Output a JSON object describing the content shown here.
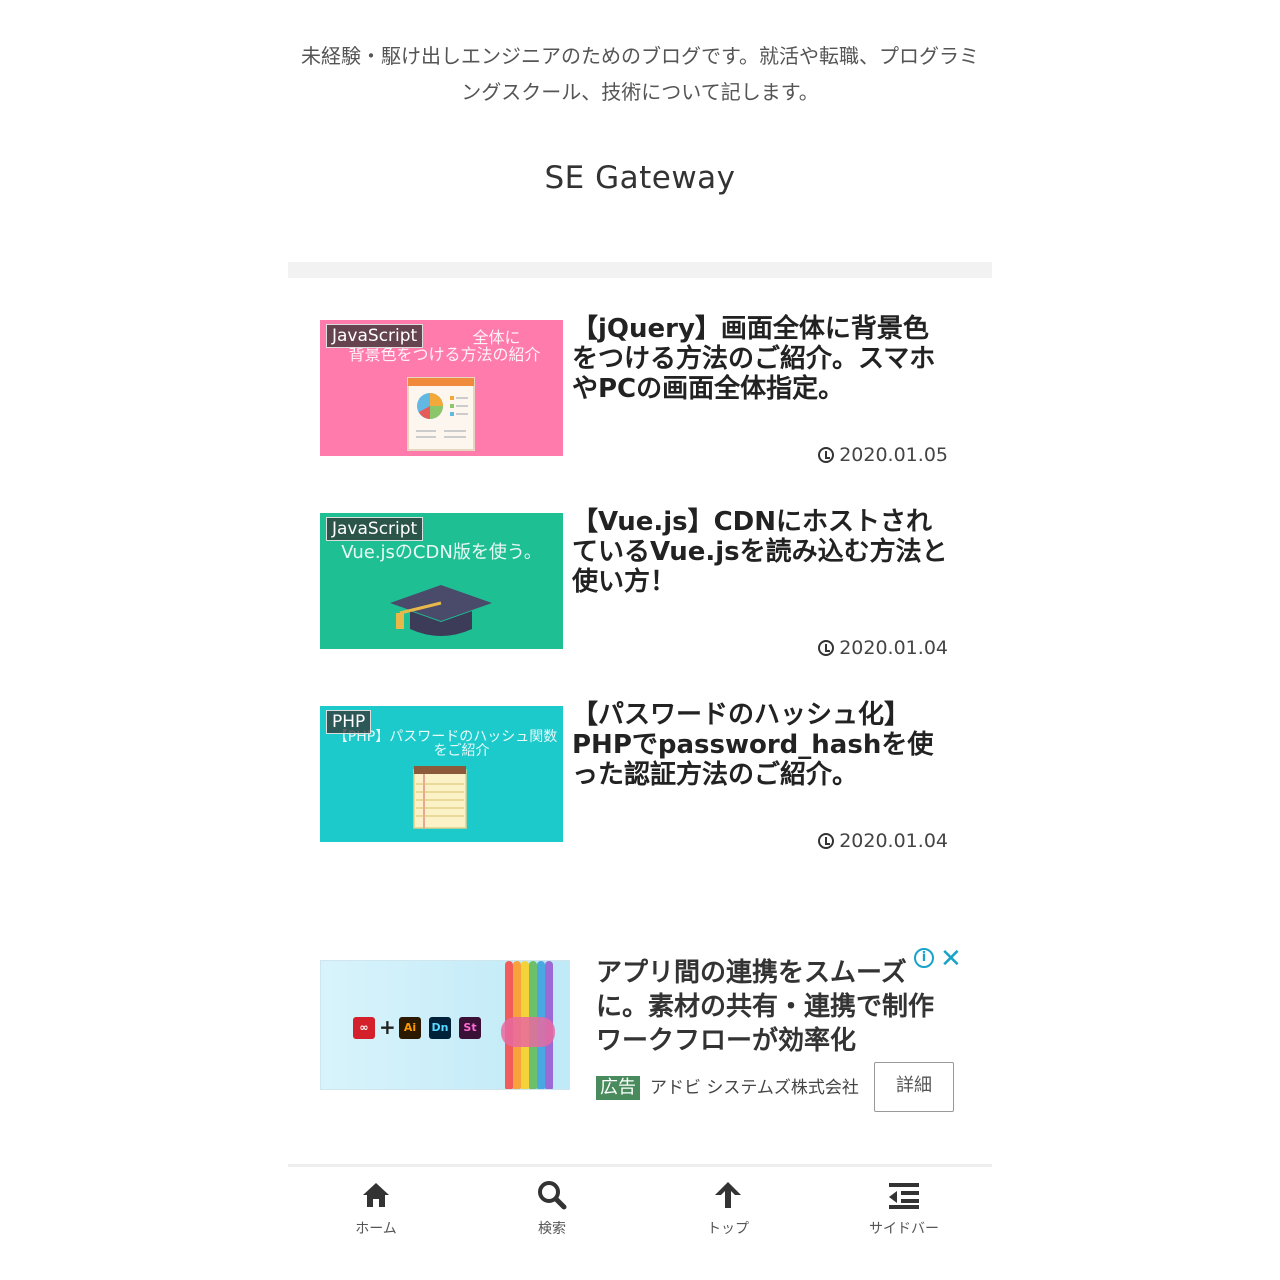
{
  "header": {
    "tagline_line1": "未経験・駆け出しエンジニアのためのブログです。就活や転職、プログラミ",
    "tagline_line2": "ングスクール、技術について記します。",
    "site_title": "SE Gateway"
  },
  "articles": [
    {
      "category": "JavaScript",
      "thumb_text_1": "全体に",
      "thumb_text_2": "背景色をつける方法の紹介",
      "thumb_color": "#ff7bac",
      "title": "【jQuery】画面全体に背景色をつける方法のご紹介。スマホやPCの画面全体指定。",
      "date": "2020.01.05",
      "thumb_icon": "pie-chart-report-icon"
    },
    {
      "category": "JavaScript",
      "thumb_text_1": "Vue.jsのCDN版を使う。",
      "thumb_text_2": "",
      "thumb_color": "#1fbf94",
      "title": "【Vue.js】CDNにホストされているVue.jsを読み込む方法と使い方！",
      "date": "2020.01.04",
      "thumb_icon": "graduation-cap-icon"
    },
    {
      "category": "PHP",
      "thumb_text_1": "【PHP】パスワードのハッシュ関数",
      "thumb_text_2": "をご紹介",
      "thumb_color": "#1ccacb",
      "title": "【パスワードのハッシュ化】PHPでpassword_hashを使った認証方法のご紹介。",
      "date": "2020.01.04",
      "thumb_icon": "notepad-icon"
    }
  ],
  "ad": {
    "title": "アプリ間の連携をスムーズに。素材の共有・連携で制作ワークフローが効率化",
    "badge": "広告",
    "advertiser": "アドビ システムズ株式会社",
    "button_label": "詳細",
    "info_symbol": "i",
    "close_symbol": "✕",
    "apps": [
      "Ai",
      "Dn",
      "St"
    ],
    "plus": "+"
  },
  "bottom_nav": {
    "home": "ホーム",
    "search": "検索",
    "top": "トップ",
    "sidebar": "サイドバー"
  }
}
